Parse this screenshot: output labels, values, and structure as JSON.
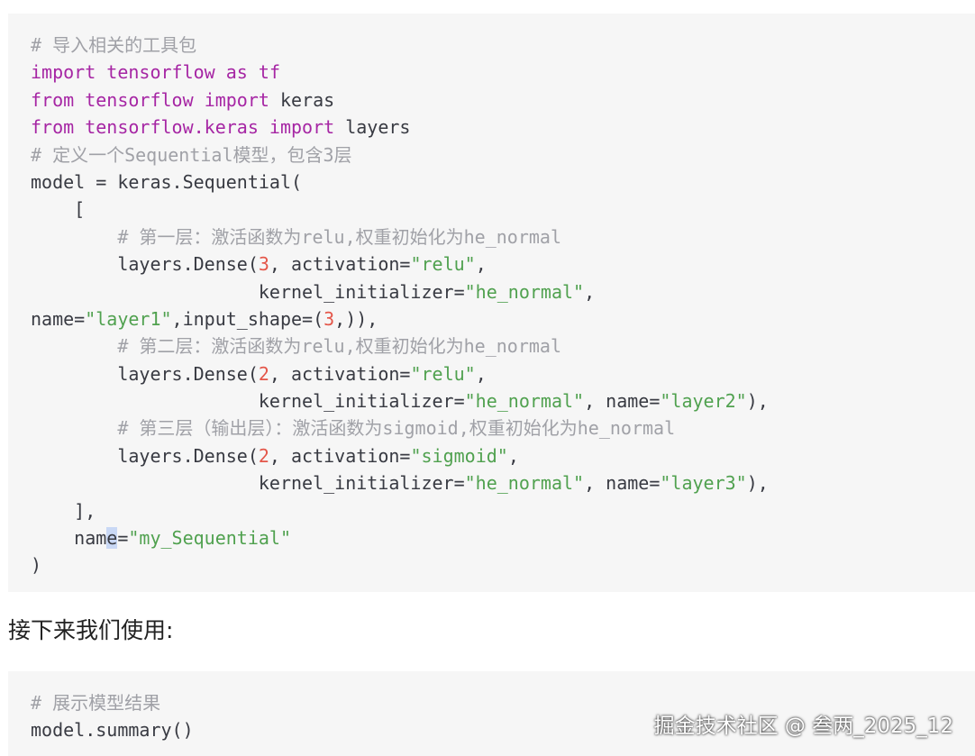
{
  "code_block_1": {
    "lines": [
      [
        {
          "t": "# 导入相关的工具包",
          "c": "cm"
        }
      ],
      [
        {
          "t": "import",
          "c": "kw"
        },
        {
          "t": " ",
          "c": "pl"
        },
        {
          "t": "tensorflow",
          "c": "kw"
        },
        {
          "t": " ",
          "c": "pl"
        },
        {
          "t": "as",
          "c": "kw"
        },
        {
          "t": " ",
          "c": "pl"
        },
        {
          "t": "tf",
          "c": "kw"
        }
      ],
      [
        {
          "t": "from",
          "c": "kw"
        },
        {
          "t": " ",
          "c": "pl"
        },
        {
          "t": "tensorflow",
          "c": "kw"
        },
        {
          "t": " ",
          "c": "pl"
        },
        {
          "t": "import",
          "c": "kw"
        },
        {
          "t": " keras",
          "c": "pl"
        }
      ],
      [
        {
          "t": "from",
          "c": "kw"
        },
        {
          "t": " ",
          "c": "pl"
        },
        {
          "t": "tensorflow.keras",
          "c": "kw"
        },
        {
          "t": " ",
          "c": "pl"
        },
        {
          "t": "import",
          "c": "kw"
        },
        {
          "t": " layers",
          "c": "pl"
        }
      ],
      [
        {
          "t": "# 定义一个Sequential模型，包含3层",
          "c": "cm"
        }
      ],
      [
        {
          "t": "model = keras.Sequential(",
          "c": "pl"
        }
      ],
      [
        {
          "t": "    [",
          "c": "pl"
        }
      ],
      [
        {
          "t": "        ",
          "c": "pl"
        },
        {
          "t": "# 第一层：激活函数为relu,权重初始化为he_normal",
          "c": "cm"
        }
      ],
      [
        {
          "t": "        layers.Dense(",
          "c": "pl"
        },
        {
          "t": "3",
          "c": "nm"
        },
        {
          "t": ", activation=",
          "c": "pl"
        },
        {
          "t": "\"relu\"",
          "c": "st"
        },
        {
          "t": ",",
          "c": "pl"
        }
      ],
      [
        {
          "t": "                     kernel_initializer=",
          "c": "pl"
        },
        {
          "t": "\"he_normal\"",
          "c": "st"
        },
        {
          "t": ",",
          "c": "pl"
        }
      ],
      [
        {
          "t": "name=",
          "c": "pl"
        },
        {
          "t": "\"layer1\"",
          "c": "st"
        },
        {
          "t": ",input_shape=(",
          "c": "pl"
        },
        {
          "t": "3",
          "c": "nm"
        },
        {
          "t": ",)),",
          "c": "pl"
        }
      ],
      [
        {
          "t": "        ",
          "c": "pl"
        },
        {
          "t": "# 第二层：激活函数为relu,权重初始化为he_normal",
          "c": "cm"
        }
      ],
      [
        {
          "t": "        layers.Dense(",
          "c": "pl"
        },
        {
          "t": "2",
          "c": "nm"
        },
        {
          "t": ", activation=",
          "c": "pl"
        },
        {
          "t": "\"relu\"",
          "c": "st"
        },
        {
          "t": ",",
          "c": "pl"
        }
      ],
      [
        {
          "t": "                     kernel_initializer=",
          "c": "pl"
        },
        {
          "t": "\"he_normal\"",
          "c": "st"
        },
        {
          "t": ", name=",
          "c": "pl"
        },
        {
          "t": "\"layer2\"",
          "c": "st"
        },
        {
          "t": "),",
          "c": "pl"
        }
      ],
      [
        {
          "t": "        ",
          "c": "pl"
        },
        {
          "t": "# 第三层（输出层）：激活函数为sigmoid,权重初始化为he_normal",
          "c": "cm"
        }
      ],
      [
        {
          "t": "        layers.Dense(",
          "c": "pl"
        },
        {
          "t": "2",
          "c": "nm"
        },
        {
          "t": ", activation=",
          "c": "pl"
        },
        {
          "t": "\"sigmoid\"",
          "c": "st"
        },
        {
          "t": ",",
          "c": "pl"
        }
      ],
      [
        {
          "t": "                     kernel_initializer=",
          "c": "pl"
        },
        {
          "t": "\"he_normal\"",
          "c": "st"
        },
        {
          "t": ", name=",
          "c": "pl"
        },
        {
          "t": "\"layer3\"",
          "c": "st"
        },
        {
          "t": "),",
          "c": "pl"
        }
      ],
      [
        {
          "t": "    ],",
          "c": "pl"
        }
      ],
      [
        {
          "t": "    nam",
          "c": "pl"
        },
        {
          "t": "e",
          "c": "hl"
        },
        {
          "t": "=",
          "c": "pl"
        },
        {
          "t": "\"my_Sequential\"",
          "c": "st"
        }
      ],
      [
        {
          "t": ")",
          "c": "pl"
        }
      ]
    ]
  },
  "section_text": "接下来我们使用:",
  "code_block_2": {
    "lines": [
      [
        {
          "t": "# 展示模型结果",
          "c": "cm"
        }
      ],
      [
        {
          "t": "model.summary()",
          "c": "pl"
        }
      ]
    ]
  },
  "watermark": "掘金技术社区 @ 叁两_2025_12",
  "colors": {
    "keyword": "#a626a4",
    "comment": "#a0a1a7",
    "string": "#50a14f",
    "number": "#e45649",
    "plain": "#383a42",
    "code_background": "#f6f6f6",
    "selection_highlight": "#c9d8f5"
  }
}
